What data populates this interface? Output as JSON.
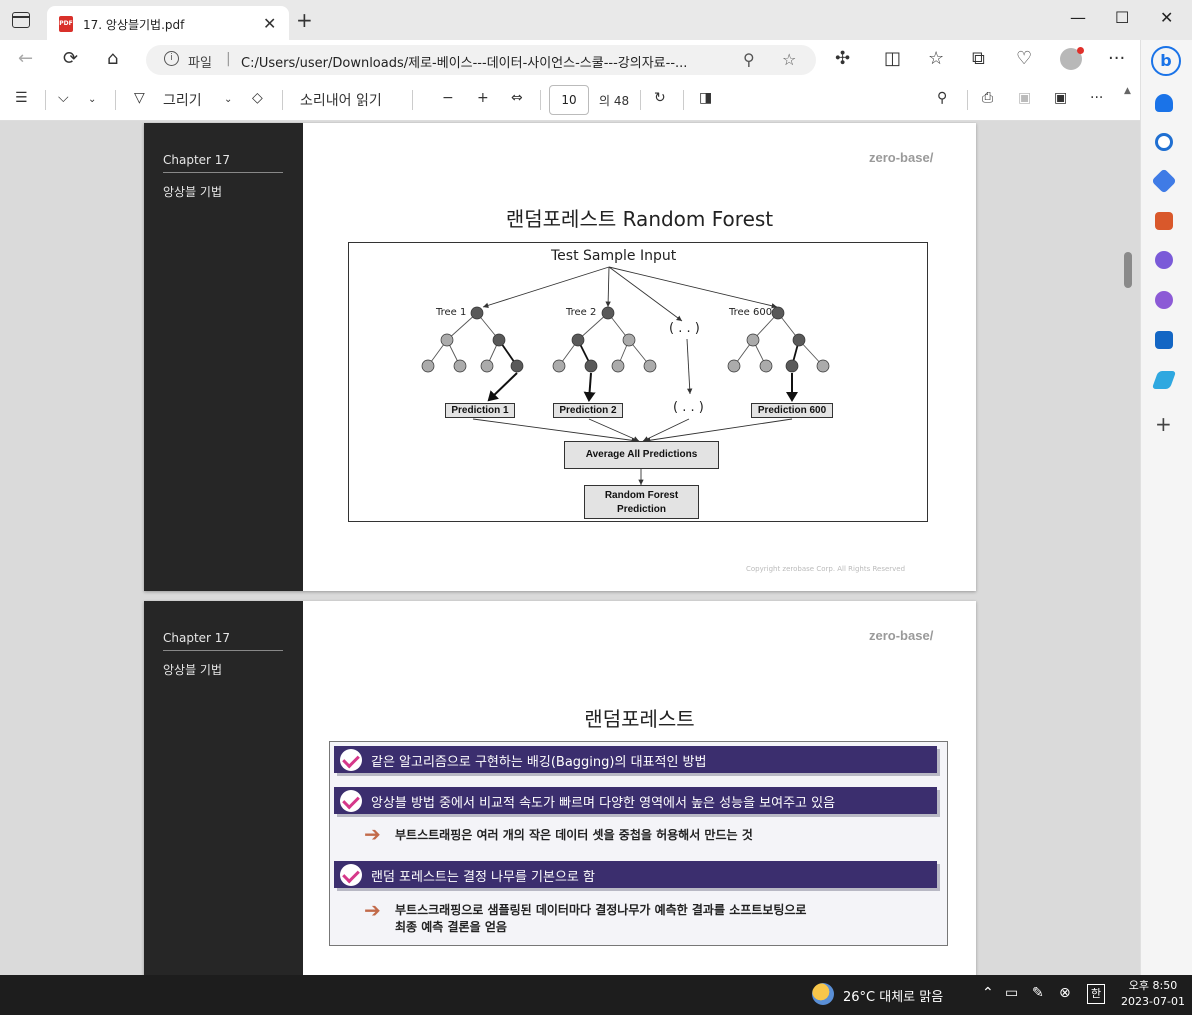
{
  "browser": {
    "tab_title": "17. 앙상블기법.pdf",
    "pdf_badge": "PDF",
    "address_label": "파일",
    "address_separator": "|",
    "url": "C:/Users/user/Downloads/제로-베이스---데이터-사이언스-스쿨---강의자료--...",
    "bing_letter": "b"
  },
  "icons": {
    "back": "back-arrow-icon",
    "refresh": "refresh-icon",
    "home": "home-icon",
    "zoom": "magnifier-icon",
    "favorite": "star-icon",
    "extensions": "puzzle-icon"
  },
  "pdf_toolbar": {
    "draw_label": "그리기",
    "read_aloud_label": "소리내어 읽기",
    "current_page": "10",
    "total_pages": "의 48"
  },
  "page1": {
    "chapter": "Chapter   17",
    "chapter_sub": "앙상블 기법",
    "logo": "zero-base/",
    "title": "랜덤포레스트 Random Forest",
    "copyright": "Copyright zerobase Corp. All Rights Reserved",
    "diagram": {
      "input_label": "Test Sample Input",
      "tree1": "Tree 1",
      "tree2": "Tree 2",
      "tree_dots": "( . . )",
      "tree600": "Tree 600",
      "pred1": "Prediction 1",
      "pred2": "Prediction 2",
      "pred_dots": "( . . )",
      "pred600": "Prediction 600",
      "average": "Average All Predictions",
      "final_line1": "Random Forest",
      "final_line2": "Prediction"
    }
  },
  "page2": {
    "chapter": "Chapter   17",
    "chapter_sub": "앙상블 기법",
    "logo": "zero-base/",
    "title": "랜덤포레스트",
    "bullets": [
      "같은 알고리즘으로 구현하는 배깅(Bagging)의 대표적인 방법",
      "앙상블 방법 중에서 비교적 속도가 빠르며 다양한 영역에서 높은 성능을 보여주고 있음",
      "랜덤 포레스트는 결정 나무를 기본으로 함"
    ],
    "sub1": "부트스트래핑은 여러 개의 작은 데이터 셋을 중첩을 허용해서 만드는 것",
    "sub2_line1": "부트스크래핑으로 샘플링된 데이터마다 결정나무가 예측한 결과를 소프트보팅으로",
    "sub2_line2": "최종 예측 결론을 얻음"
  },
  "taskbar": {
    "weather": "26°C  대체로 맑음",
    "ime": "한",
    "time": "오후 8:50",
    "date": "2023-07-01"
  }
}
